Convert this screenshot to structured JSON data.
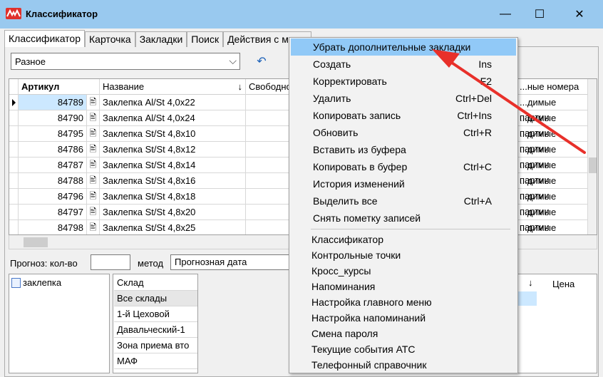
{
  "window": {
    "title": "Классификатор",
    "minimize_glyph": "—",
    "maximize_glyph": "☐",
    "close_glyph": "✕"
  },
  "tabs": [
    {
      "label": "Классификатор",
      "active": true
    },
    {
      "label": "Карточка"
    },
    {
      "label": "Закладки"
    },
    {
      "label": "Поиск"
    },
    {
      "label": "Действия с меню"
    }
  ],
  "filter": {
    "group_value": "Разное",
    "arrow": "⌵",
    "undo_icon": "↶"
  },
  "grid": {
    "columns": [
      "Артикул",
      "Название",
      "Свободно",
      "...ные номера"
    ],
    "sort_glyph": "↓",
    "right_column_value": "...димые партии",
    "rows": [
      {
        "article": "84789",
        "name": "Заклепка Al/St 4,0x22",
        "current": true
      },
      {
        "article": "84790",
        "name": "Заклепка Al/St 4,0x24"
      },
      {
        "article": "84795",
        "name": "Заклепка St/St 4,8x10"
      },
      {
        "article": "84786",
        "name": "Заклепка St/St 4,8x12"
      },
      {
        "article": "84787",
        "name": "Заклепка St/St 4,8x14"
      },
      {
        "article": "84788",
        "name": "Заклепка St/St 4,8x16"
      },
      {
        "article": "84796",
        "name": "Заклепка St/St 4,8x18"
      },
      {
        "article": "84797",
        "name": "Заклепка St/St 4,8x20"
      },
      {
        "article": "84798",
        "name": "Заклепка St/St 4,8x25"
      }
    ]
  },
  "forecast": {
    "label": "Прогноз: кол-во",
    "qty_value": "",
    "method_label": "метод",
    "method_value": "Прогнозная дата"
  },
  "tree": {
    "item": "заклепка"
  },
  "warehouses": {
    "header": "Склад",
    "items": [
      "Все склады",
      "1-й Цеховой",
      "Давальческий-1",
      "Зона приема вто",
      "МАФ"
    ]
  },
  "right_panel": {
    "sort_glyph": "↓",
    "price_header": "Цена"
  },
  "context_menu": {
    "items": [
      {
        "label": "Убрать дополнительные закладки",
        "shortcut": "",
        "highlight": true
      },
      {
        "label": "Создать",
        "shortcut": "Ins"
      },
      {
        "label": "Корректировать",
        "shortcut": "F2"
      },
      {
        "label": "Удалить",
        "shortcut": "Ctrl+Del"
      },
      {
        "label": "Копировать запись",
        "shortcut": "Ctrl+Ins"
      },
      {
        "label": "Обновить",
        "shortcut": "Ctrl+R"
      },
      {
        "label": "Вставить из буфера",
        "shortcut": ""
      },
      {
        "label": "Копировать в буфер",
        "shortcut": "Ctrl+C"
      },
      {
        "label": "История изменений",
        "shortcut": ""
      },
      {
        "label": "Выделить все",
        "shortcut": "Ctrl+A"
      },
      {
        "label": "Снять пометку записей",
        "shortcut": ""
      }
    ],
    "items2": [
      "Классификатор",
      "Контрольные точки",
      "Кросс_курсы",
      "Напоминания",
      "Настройка главного меню",
      "Настройка напоминаний",
      "Смена пароля",
      "Текущие события АТС",
      "Телефонный справочник"
    ]
  },
  "colors": {
    "titlebar": "#99c9ef",
    "menu_highlight": "#91c9f7",
    "annotation_arrow": "#e8302a"
  }
}
